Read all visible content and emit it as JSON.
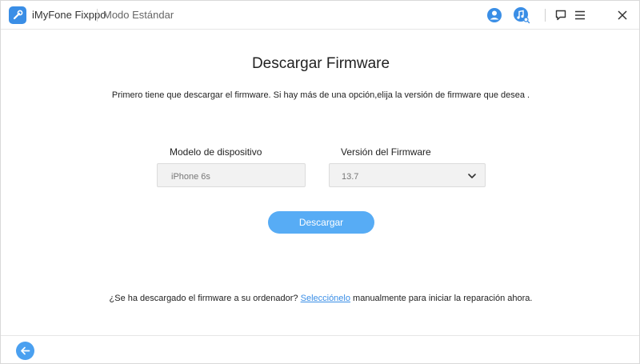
{
  "app": {
    "name": "iMyFone Fixppo",
    "mode": "Modo Estándar"
  },
  "titlebar": {
    "icons": [
      "user-icon",
      "music-search-icon",
      "feedback-icon",
      "menu-icon",
      "close-icon"
    ]
  },
  "main": {
    "title": "Descargar Firmware",
    "subtitle": "Primero tiene que descargar el firmware. Si hay más de una opción,elija la versión de firmware que desea .",
    "device_model": {
      "label": "Modelo de dispositivo",
      "value": "iPhone 6s"
    },
    "firmware_version": {
      "label": "Versión del Firmware",
      "selected": "13.7"
    },
    "download_label": "Descargar",
    "hint": {
      "before": "¿Se ha descargado el firmware a su ordenador? ",
      "link": "Selecciónelo",
      "after": " manualmente para iniciar la reparación ahora."
    }
  },
  "colors": {
    "accent": "#57acf5",
    "link": "#3a8ee6",
    "icon_blue": "#3a8ee6"
  }
}
